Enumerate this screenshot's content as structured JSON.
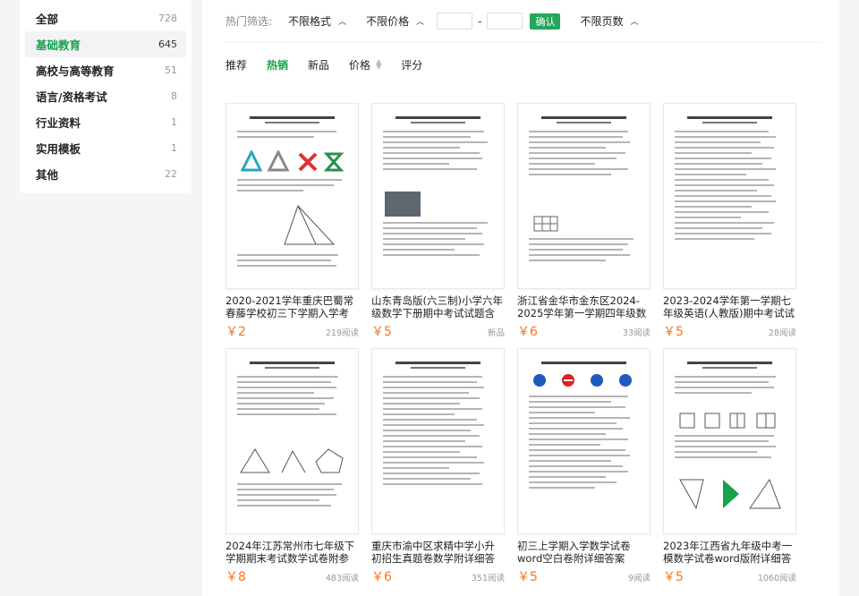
{
  "sidebar": {
    "items": [
      {
        "label": "全部",
        "count": "728"
      },
      {
        "label": "基础教育",
        "count": "645"
      },
      {
        "label": "高校与高等教育",
        "count": "51"
      },
      {
        "label": "语言/资格考试",
        "count": "8"
      },
      {
        "label": "行业资料",
        "count": "1"
      },
      {
        "label": "实用模板",
        "count": "1"
      },
      {
        "label": "其他",
        "count": "22"
      }
    ],
    "active_index": 1
  },
  "filters": {
    "title": "热门筛选:",
    "format_label": "不限格式",
    "price_label": "不限价格",
    "price_min_placeholder": "",
    "price_max_placeholder": "",
    "dash": "-",
    "confirm_label": "确认",
    "pages_label": "不限页数"
  },
  "sort": {
    "recommend": "推荐",
    "hot": "热销",
    "new": "新品",
    "price": "价格",
    "rating": "评分",
    "active": "hot"
  },
  "documents": [
    {
      "title": "2020-2021学年重庆巴蜀常春藤学校初三下学期入学考试数学...",
      "price": "￥2",
      "reads": "219阅读"
    },
    {
      "title": "山东青岛版(六三制)小学六年级数学下册期中考试试题含参考答案",
      "price": "￥5",
      "reads": "新品"
    },
    {
      "title": "浙江省金华市金东区2024-2025学年第一学期四年级数学期末...",
      "price": "￥6",
      "reads": "33阅读"
    },
    {
      "title": "2023-2024学年第一学期七年级英语(人教版)期中考试试卷附参...",
      "price": "￥5",
      "reads": "28阅读"
    },
    {
      "title": "2024年江苏常州市七年级下学期期末考试数学试卷附参考答案",
      "price": "￥8",
      "reads": "483阅读"
    },
    {
      "title": "重庆市渝中区求精中学小升初招生真题卷数学附详细答案",
      "price": "￥6",
      "reads": "351阅读"
    },
    {
      "title": "初三上学期入学数学试卷word空白卷附详细答案",
      "price": "￥5",
      "reads": "9阅读"
    },
    {
      "title": "2023年江西省九年级中考一模数学试卷word版附详细答案",
      "price": "￥5",
      "reads": "1060阅读"
    }
  ],
  "colors": {
    "accent_green": "#1aa14f",
    "price_orange": "#f5761f"
  }
}
